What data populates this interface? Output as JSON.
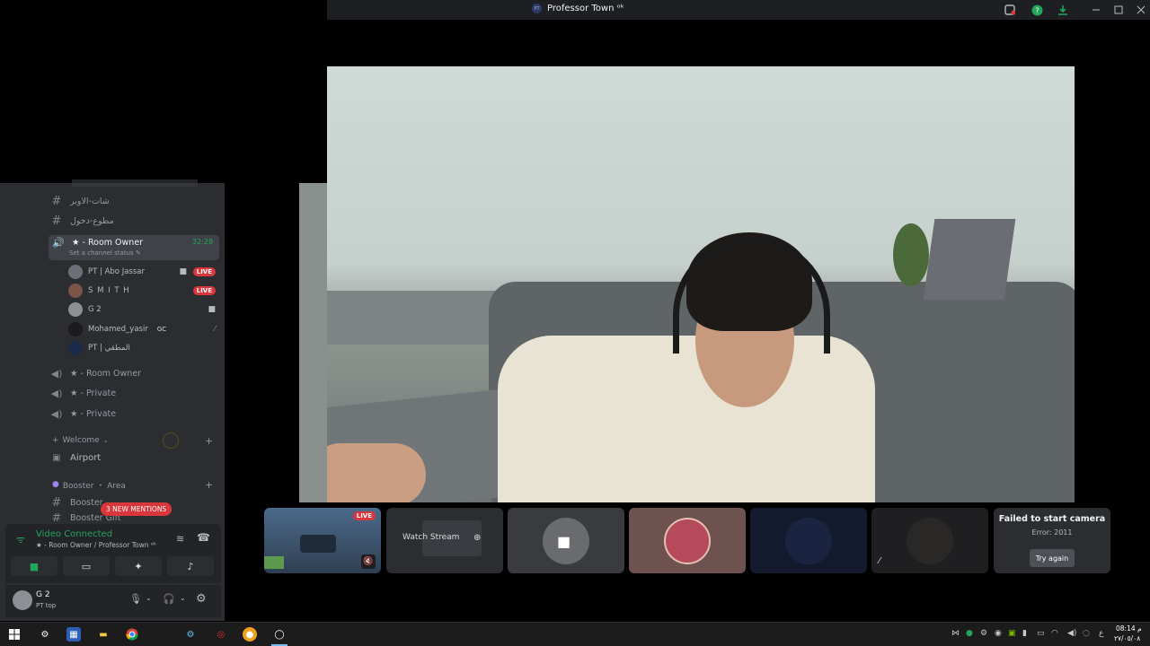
{
  "window": {
    "title": "Professor Town ᵒᵏ",
    "title_logo": "PT"
  },
  "sidebar": {
    "text_channels": [
      {
        "label": "شات-الاوبر"
      },
      {
        "label": "مطوع-دخول"
      }
    ],
    "active_voice": {
      "label": "★ - Room Owner",
      "timer": "32:28",
      "status_hint": "Set a channel status ✎"
    },
    "voice_users": [
      {
        "name": "PT | Abo Jassar",
        "live": "LIVE"
      },
      {
        "name": "S M I T H",
        "live": "LIVE"
      },
      {
        "name": "G 2",
        "live": ""
      },
      {
        "name": "Mohamed_yasir",
        "tag": "GC",
        "live": ""
      },
      {
        "name": "PT | المطقي",
        "live": ""
      }
    ],
    "voice_channels": [
      {
        "label": "★ - Room Owner"
      },
      {
        "label": "★ - Private"
      },
      {
        "label": "★ - Private"
      }
    ],
    "categories": [
      {
        "label": "Welcome"
      },
      {
        "label": "Booster ・ Area"
      }
    ],
    "airport": "Airport",
    "booster_channel": "Booster",
    "booster_gift": "Booster Gift",
    "mentions": "3 NEW MENTIONS"
  },
  "voice_panel": {
    "status": "Video Connected",
    "subtitle": "★ - Room Owner / Professor Town ᵒᵏ"
  },
  "user_panel": {
    "name": "G 2",
    "status": "PT top"
  },
  "tiles": {
    "live_label": "LIVE",
    "watch_stream": "Watch Stream"
  },
  "error_card": {
    "title": "Failed to start camera",
    "error": "Error: 2011",
    "retry": "Try again"
  },
  "clock": {
    "time": "08:14 م",
    "date": "٢٧/٠٥/٠٨"
  },
  "colors": {
    "accent_green": "#23a55a",
    "live_red": "#da373c",
    "sidebar_bg": "#2b2d31",
    "panel_bg": "#232428"
  }
}
